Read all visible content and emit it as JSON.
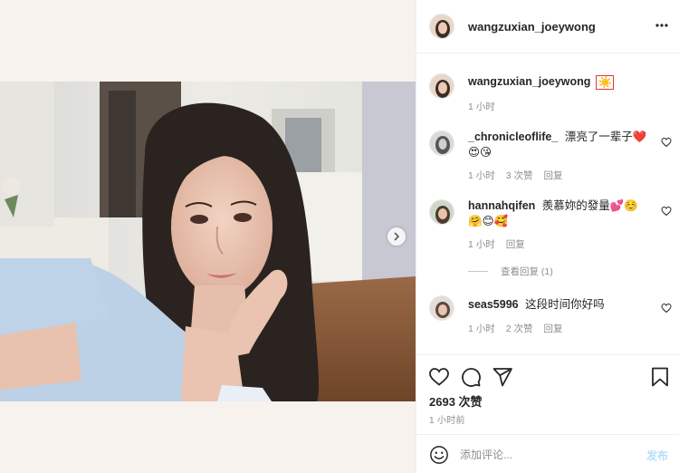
{
  "post": {
    "username": "wangzuxian_joeywong",
    "caption_emoji": "☀️",
    "caption_time": "1 小时",
    "likes_text": "2693 次赞",
    "time_ago": "1 小时前"
  },
  "header": {
    "username": "wangzuxian_joeywong"
  },
  "comments": [
    {
      "username": "_chronicleoflife_",
      "text": "漂亮了一辈子❤️😍😘",
      "time": "1 小时",
      "likes": "3 次赞",
      "reply": "回复"
    },
    {
      "username": "hannahqifen",
      "text": "羨慕妳的發量💕☺️🤗😊🥰",
      "time": "1 小时",
      "reply": "回复",
      "view_replies": "查看回复 (1)"
    },
    {
      "username": "seas5996",
      "text": "这段时间你好吗",
      "time": "1 小时",
      "likes": "2 次赞",
      "reply": "回复"
    }
  ],
  "composer": {
    "placeholder": "添加评论...",
    "post_label": "发布"
  },
  "colors": {
    "accent": "#e8372c",
    "post_disabled": "#b2dffc",
    "border": "#efefef"
  },
  "icons": [
    "more-icon",
    "heart-icon",
    "comment-icon",
    "share-icon",
    "bookmark-icon",
    "emoji-icon",
    "chevron-right-icon"
  ]
}
